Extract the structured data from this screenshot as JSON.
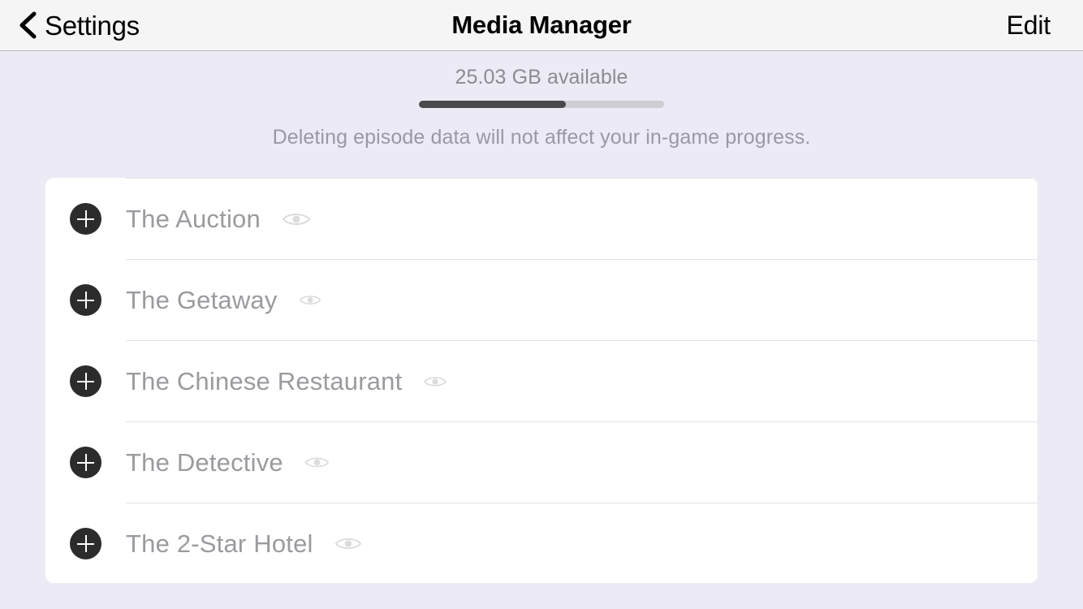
{
  "navbar": {
    "back_label": "Settings",
    "back_icon": "chevron-left-icon",
    "title": "Media Manager",
    "edit_label": "Edit"
  },
  "storage": {
    "available_label": "25.03 GB available",
    "progress_percent": 60,
    "note": "Deleting episode data will not affect your in-game progress."
  },
  "colors": {
    "page_background": "#eceaf4",
    "navbar_background": "#f5f5f6",
    "card_background": "#ffffff",
    "row_title": "#9b9b9f",
    "plus_button": "#2c2c2c",
    "progress_fill": "#4a4a4c",
    "progress_track": "#cdcdd2",
    "separator": "#e2e2e2"
  },
  "episodes": [
    {
      "title": "The Auction",
      "add_icon": "plus-circle-icon",
      "visibility_icon": "eye-icon",
      "eye_size": 1.0
    },
    {
      "title": "The Getaway",
      "add_icon": "plus-circle-icon",
      "visibility_icon": "eye-icon",
      "eye_size": 0.78
    },
    {
      "title": "The Chinese Restaurant",
      "add_icon": "plus-circle-icon",
      "visibility_icon": "eye-icon",
      "eye_size": 0.82
    },
    {
      "title": "The Detective",
      "add_icon": "plus-circle-icon",
      "visibility_icon": "eye-icon",
      "eye_size": 0.86
    },
    {
      "title": "The 2-Star Hotel",
      "add_icon": "plus-circle-icon",
      "visibility_icon": "eye-icon",
      "eye_size": 0.95
    }
  ]
}
